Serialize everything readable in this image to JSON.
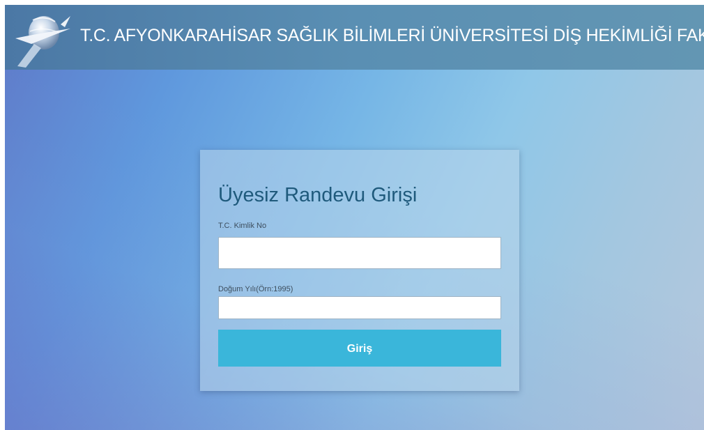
{
  "header": {
    "title": "T.C. AFYONKARAHİSAR SAĞLIK BİLİMLERİ ÜNİVERSİTESİ DİŞ HEKİMLİĞİ FAKÜLTESİ",
    "logo_icon": "university-globe-logo"
  },
  "login": {
    "title": "Üyesiz Randevu Girişi",
    "tc_label": "T.C. Kimlik No",
    "tc_value": "",
    "dogum_label": "Doğum Yılı(Örn:1995)",
    "dogum_value": "",
    "submit_label": "Giriş"
  },
  "colors": {
    "header_bg": "#5a8fb3",
    "button_bg": "#3ab6da",
    "title_text": "#1f5a7c"
  }
}
